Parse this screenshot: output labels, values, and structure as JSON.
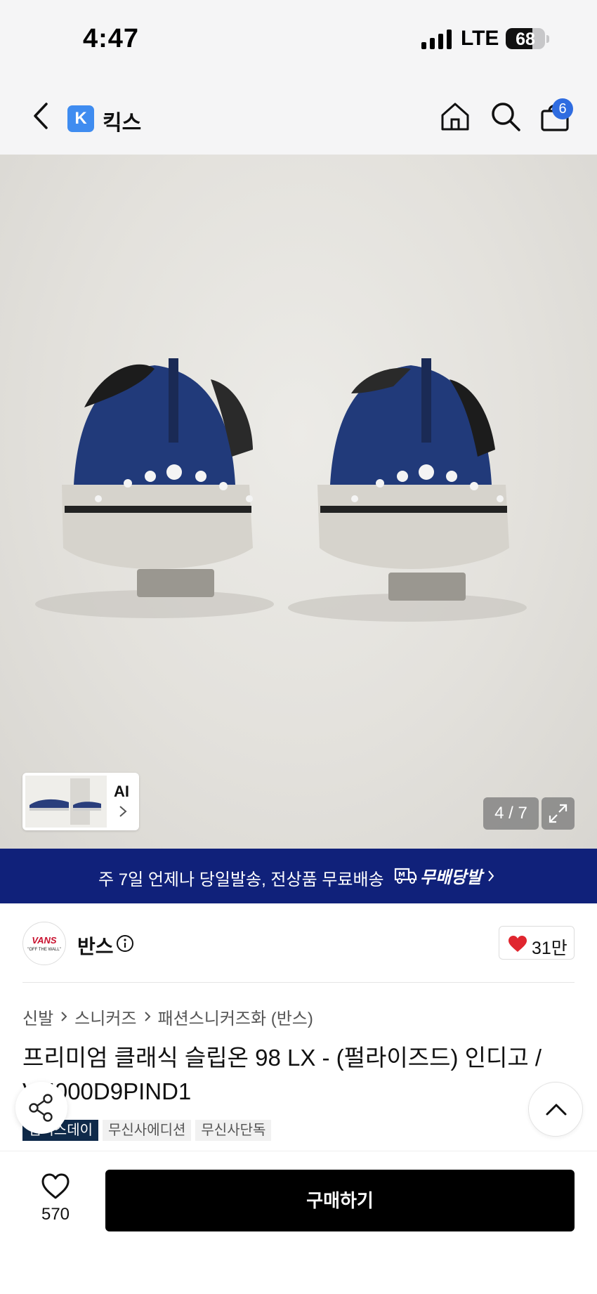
{
  "status_bar": {
    "time": "4:47",
    "network": "LTE",
    "battery": "68",
    "battery_level": 0.68
  },
  "nav": {
    "store_logo_letter": "K",
    "store_name": "킥스",
    "cart_count": "6",
    "icons": [
      "chevron-left-icon",
      "home-icon",
      "search-icon",
      "cart-icon"
    ]
  },
  "gallery": {
    "ai_label": "AI",
    "counter": "4 / 7",
    "background_color": "#e6e4df"
  },
  "promo": {
    "text": "주 7일 언제나 당일발송, 전상품 무료배송",
    "badge_label": "무배당발",
    "background_color": "#10217a"
  },
  "brand": {
    "logo_text": "VANS",
    "logo_sub": "\"OFF THE WALL\"",
    "name": "반스",
    "likes": "31만",
    "heart_color": "#e0262f"
  },
  "breadcrumb": [
    "신발",
    "스니커즈",
    "패션스니커즈화 (반스)"
  ],
  "product": {
    "title": "프리미엄 클래식 슬립온 98 LX - (펄라이즈드) 인디고 / VN000D9PIND1",
    "tags": [
      "멤버스데이",
      "무신사에디션",
      "무신사단독"
    ]
  },
  "bottom_bar": {
    "wish_count": "570",
    "buy_label": "구매하기"
  }
}
